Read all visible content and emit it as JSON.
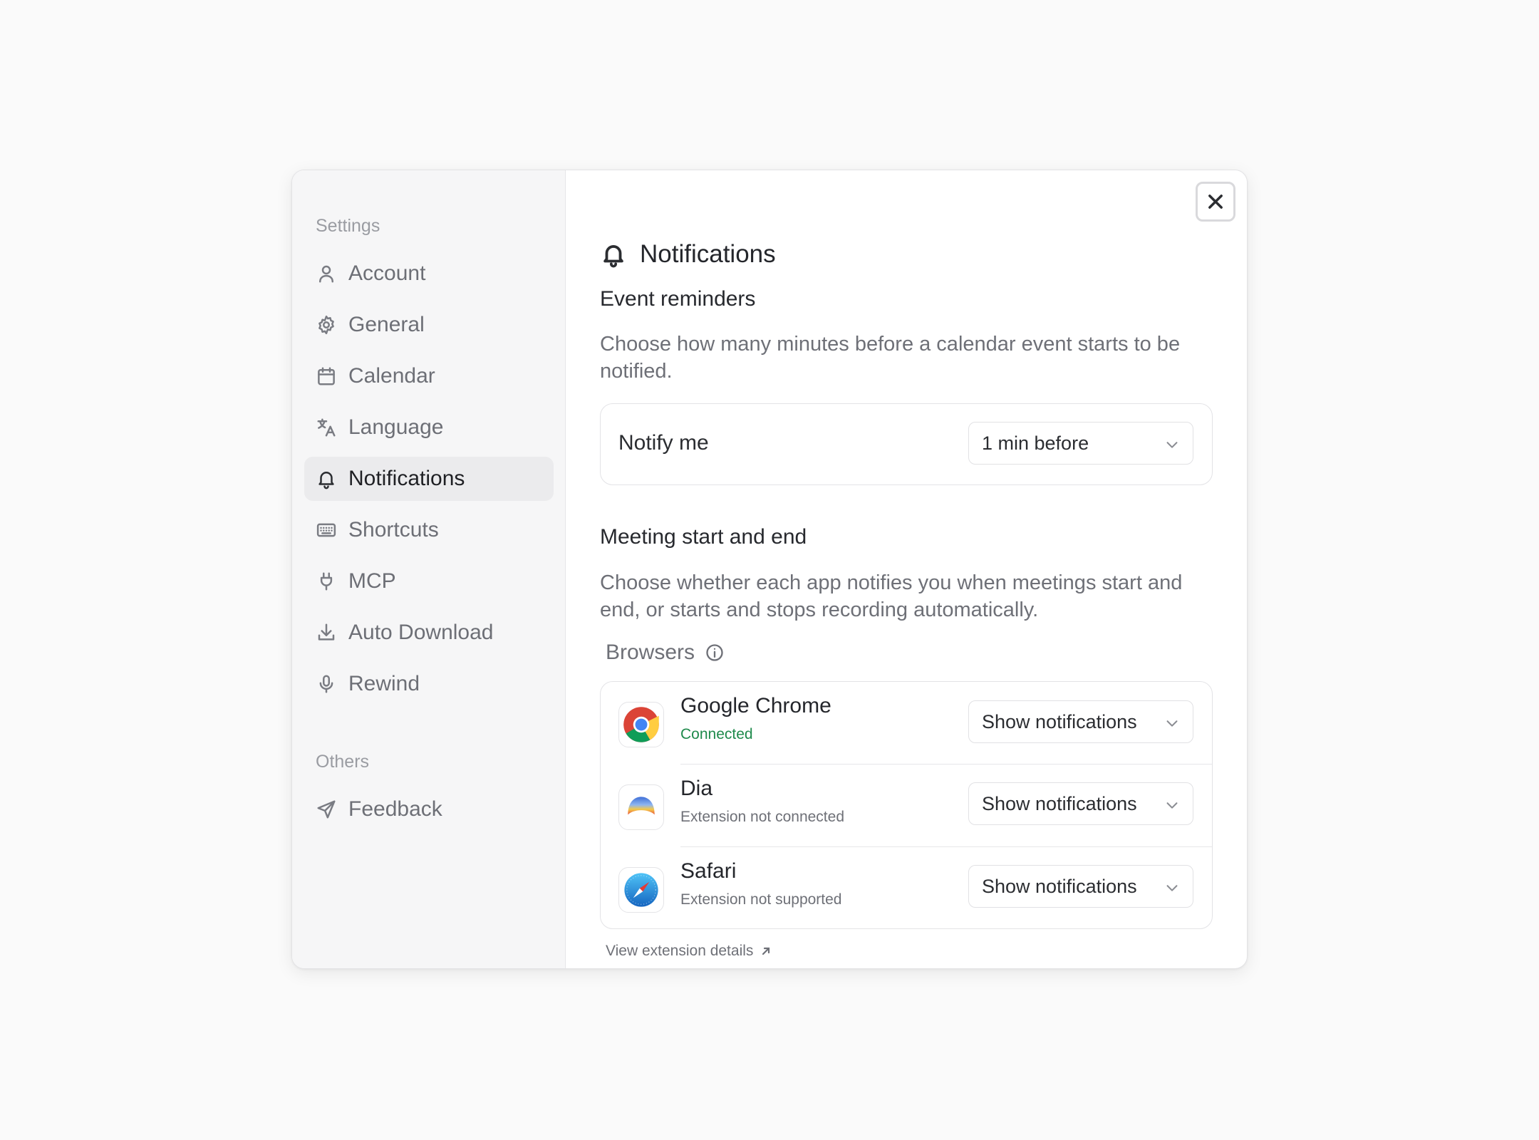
{
  "sidebar": {
    "section_settings": "Settings",
    "items": [
      {
        "label": "Account",
        "icon": "user-icon"
      },
      {
        "label": "General",
        "icon": "gear-icon"
      },
      {
        "label": "Calendar",
        "icon": "calendar-icon"
      },
      {
        "label": "Language",
        "icon": "translate-icon"
      },
      {
        "label": "Notifications",
        "icon": "bell-icon",
        "active": true
      },
      {
        "label": "Shortcuts",
        "icon": "keyboard-icon"
      },
      {
        "label": "MCP",
        "icon": "plug-icon"
      },
      {
        "label": "Auto Download",
        "icon": "download-icon"
      },
      {
        "label": "Rewind",
        "icon": "microphone-icon"
      }
    ],
    "section_others": "Others",
    "others_items": [
      {
        "label": "Feedback",
        "icon": "send-icon"
      }
    ]
  },
  "main": {
    "title": "Notifications",
    "event_reminders": {
      "heading": "Event reminders",
      "description": "Choose how many minutes before a calendar event starts to be notified.",
      "notify_label": "Notify me",
      "notify_value": "1 min before"
    },
    "meeting": {
      "heading": "Meeting start and end",
      "description": "Choose whether each app notifies you when meetings start and end, or starts and stops recording automatically.",
      "browsers_label": "Browsers",
      "browsers": [
        {
          "name": "Google Chrome",
          "status": "Connected",
          "setting": "Show notifications",
          "icon": "chrome-icon"
        },
        {
          "name": "Dia",
          "status": "Extension not connected",
          "setting": "Show notifications",
          "icon": "dia-icon"
        },
        {
          "name": "Safari",
          "status": "Extension not supported",
          "setting": "Show notifications",
          "icon": "safari-icon"
        }
      ],
      "extension_link": "View extension details"
    }
  },
  "colors": {
    "accent_connected": "#1f8a4c",
    "sidebar_bg": "#f6f6f7",
    "active_item_bg": "#ebebed"
  }
}
